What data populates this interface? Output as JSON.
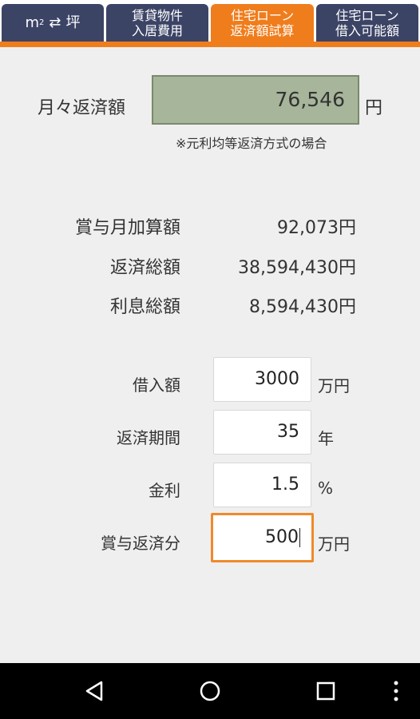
{
  "tabs": [
    {
      "label_unit": "m",
      "label_sup": "2",
      "label_arrows": "⇄",
      "label_tsubo": "坪",
      "active": false
    },
    {
      "line1": "賃貸物件",
      "line2": "入居費用",
      "active": false
    },
    {
      "line1": "住宅ローン",
      "line2": "返済額試算",
      "active": true
    },
    {
      "line1": "住宅ローン",
      "line2": "借入可能額",
      "active": false
    }
  ],
  "monthly": {
    "label": "月々返済額",
    "value": "76,546",
    "unit": "円",
    "note": "※元利均等返済方式の場合"
  },
  "summary": [
    {
      "label": "賞与月加算額",
      "value": "92,073円"
    },
    {
      "label": "返済総額",
      "value": "38,594,430円"
    },
    {
      "label": "利息総額",
      "value": "8,594,430円"
    }
  ],
  "inputs": [
    {
      "label": "借入額",
      "value": "3000",
      "unit": "万円"
    },
    {
      "label": "返済期間",
      "value": "35",
      "unit": "年"
    },
    {
      "label": "金利",
      "value": "1.5",
      "unit": "%"
    },
    {
      "label": "賞与返済分",
      "value": "500",
      "unit": "万円"
    }
  ],
  "colors": {
    "accent": "#f07d1c",
    "tab": "#3c4466",
    "result_box": "#a7b59a"
  },
  "navbar": {
    "icons": [
      "back-icon",
      "home-icon",
      "recents-icon",
      "menu-icon"
    ]
  }
}
